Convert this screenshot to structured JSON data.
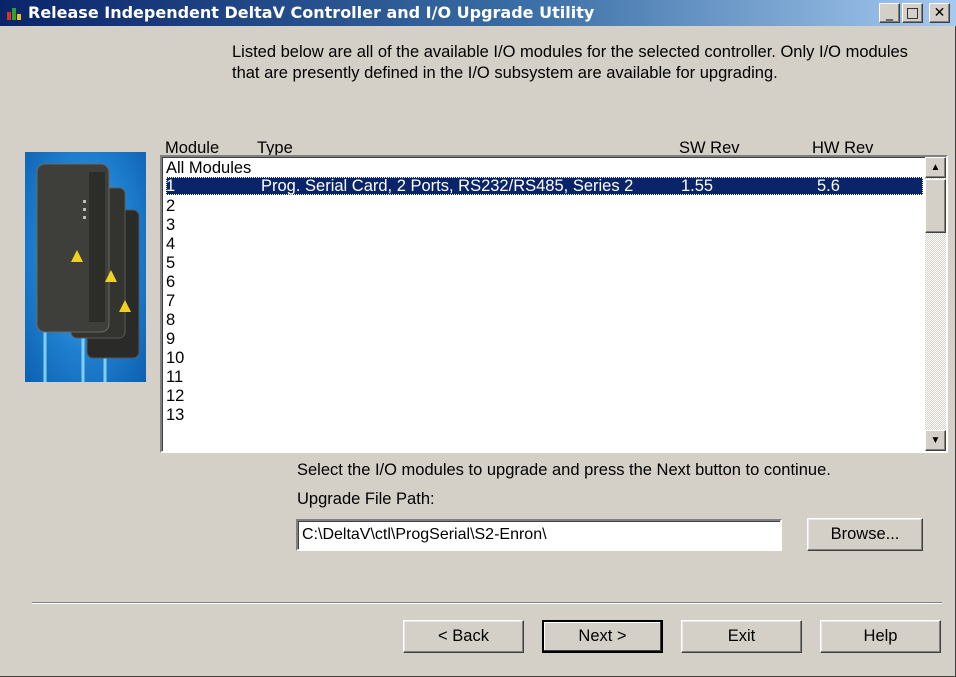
{
  "window": {
    "title": "Release Independent DeltaV Controller and I/O Upgrade Utility",
    "controls": {
      "minimize": "_",
      "maximize": "□",
      "close": "✕"
    }
  },
  "instructions": "Listed below are all of the available I/O modules for the selected controller. Only I/O modules that are presently defined in the I/O subsystem are available for upgrading.",
  "columns": {
    "module": "Module",
    "type": "Type",
    "sw_rev": "SW Rev",
    "hw_rev": "HW Rev"
  },
  "modules": [
    {
      "module": "All Modules",
      "type": "",
      "sw_rev": "",
      "hw_rev": ""
    },
    {
      "module": "1",
      "type": "Prog. Serial Card, 2 Ports, RS232/RS485, Series 2",
      "sw_rev": "1.55",
      "hw_rev": "5.6",
      "selected": true
    },
    {
      "module": "2",
      "type": "",
      "sw_rev": "",
      "hw_rev": ""
    },
    {
      "module": "3",
      "type": "",
      "sw_rev": "",
      "hw_rev": ""
    },
    {
      "module": "4",
      "type": "",
      "sw_rev": "",
      "hw_rev": ""
    },
    {
      "module": "5",
      "type": "",
      "sw_rev": "",
      "hw_rev": ""
    },
    {
      "module": "6",
      "type": "",
      "sw_rev": "",
      "hw_rev": ""
    },
    {
      "module": "7",
      "type": "",
      "sw_rev": "",
      "hw_rev": ""
    },
    {
      "module": "8",
      "type": "",
      "sw_rev": "",
      "hw_rev": ""
    },
    {
      "module": "9",
      "type": "",
      "sw_rev": "",
      "hw_rev": ""
    },
    {
      "module": "10",
      "type": "",
      "sw_rev": "",
      "hw_rev": ""
    },
    {
      "module": "11",
      "type": "",
      "sw_rev": "",
      "hw_rev": ""
    },
    {
      "module": "12",
      "type": "",
      "sw_rev": "",
      "hw_rev": ""
    },
    {
      "module": "13",
      "type": "",
      "sw_rev": "",
      "hw_rev": ""
    }
  ],
  "select_message": "Select the I/O modules to upgrade and press the Next button to continue.",
  "upgrade_path": {
    "label": "Upgrade File Path:",
    "value": "C:\\DeltaV\\ctl\\ProgSerial\\S2-Enron\\"
  },
  "buttons": {
    "browse": "Browse...",
    "back": "< Back",
    "next": "Next >",
    "exit": "Exit",
    "help": "Help"
  },
  "colors": {
    "title_bar": "#0a246a",
    "selection": "#0a246a",
    "dialog_face": "#d4d0c8",
    "photo_background": "#1f7fcf"
  },
  "icons": {
    "scroll_up": "▲",
    "scroll_down": "▼"
  }
}
